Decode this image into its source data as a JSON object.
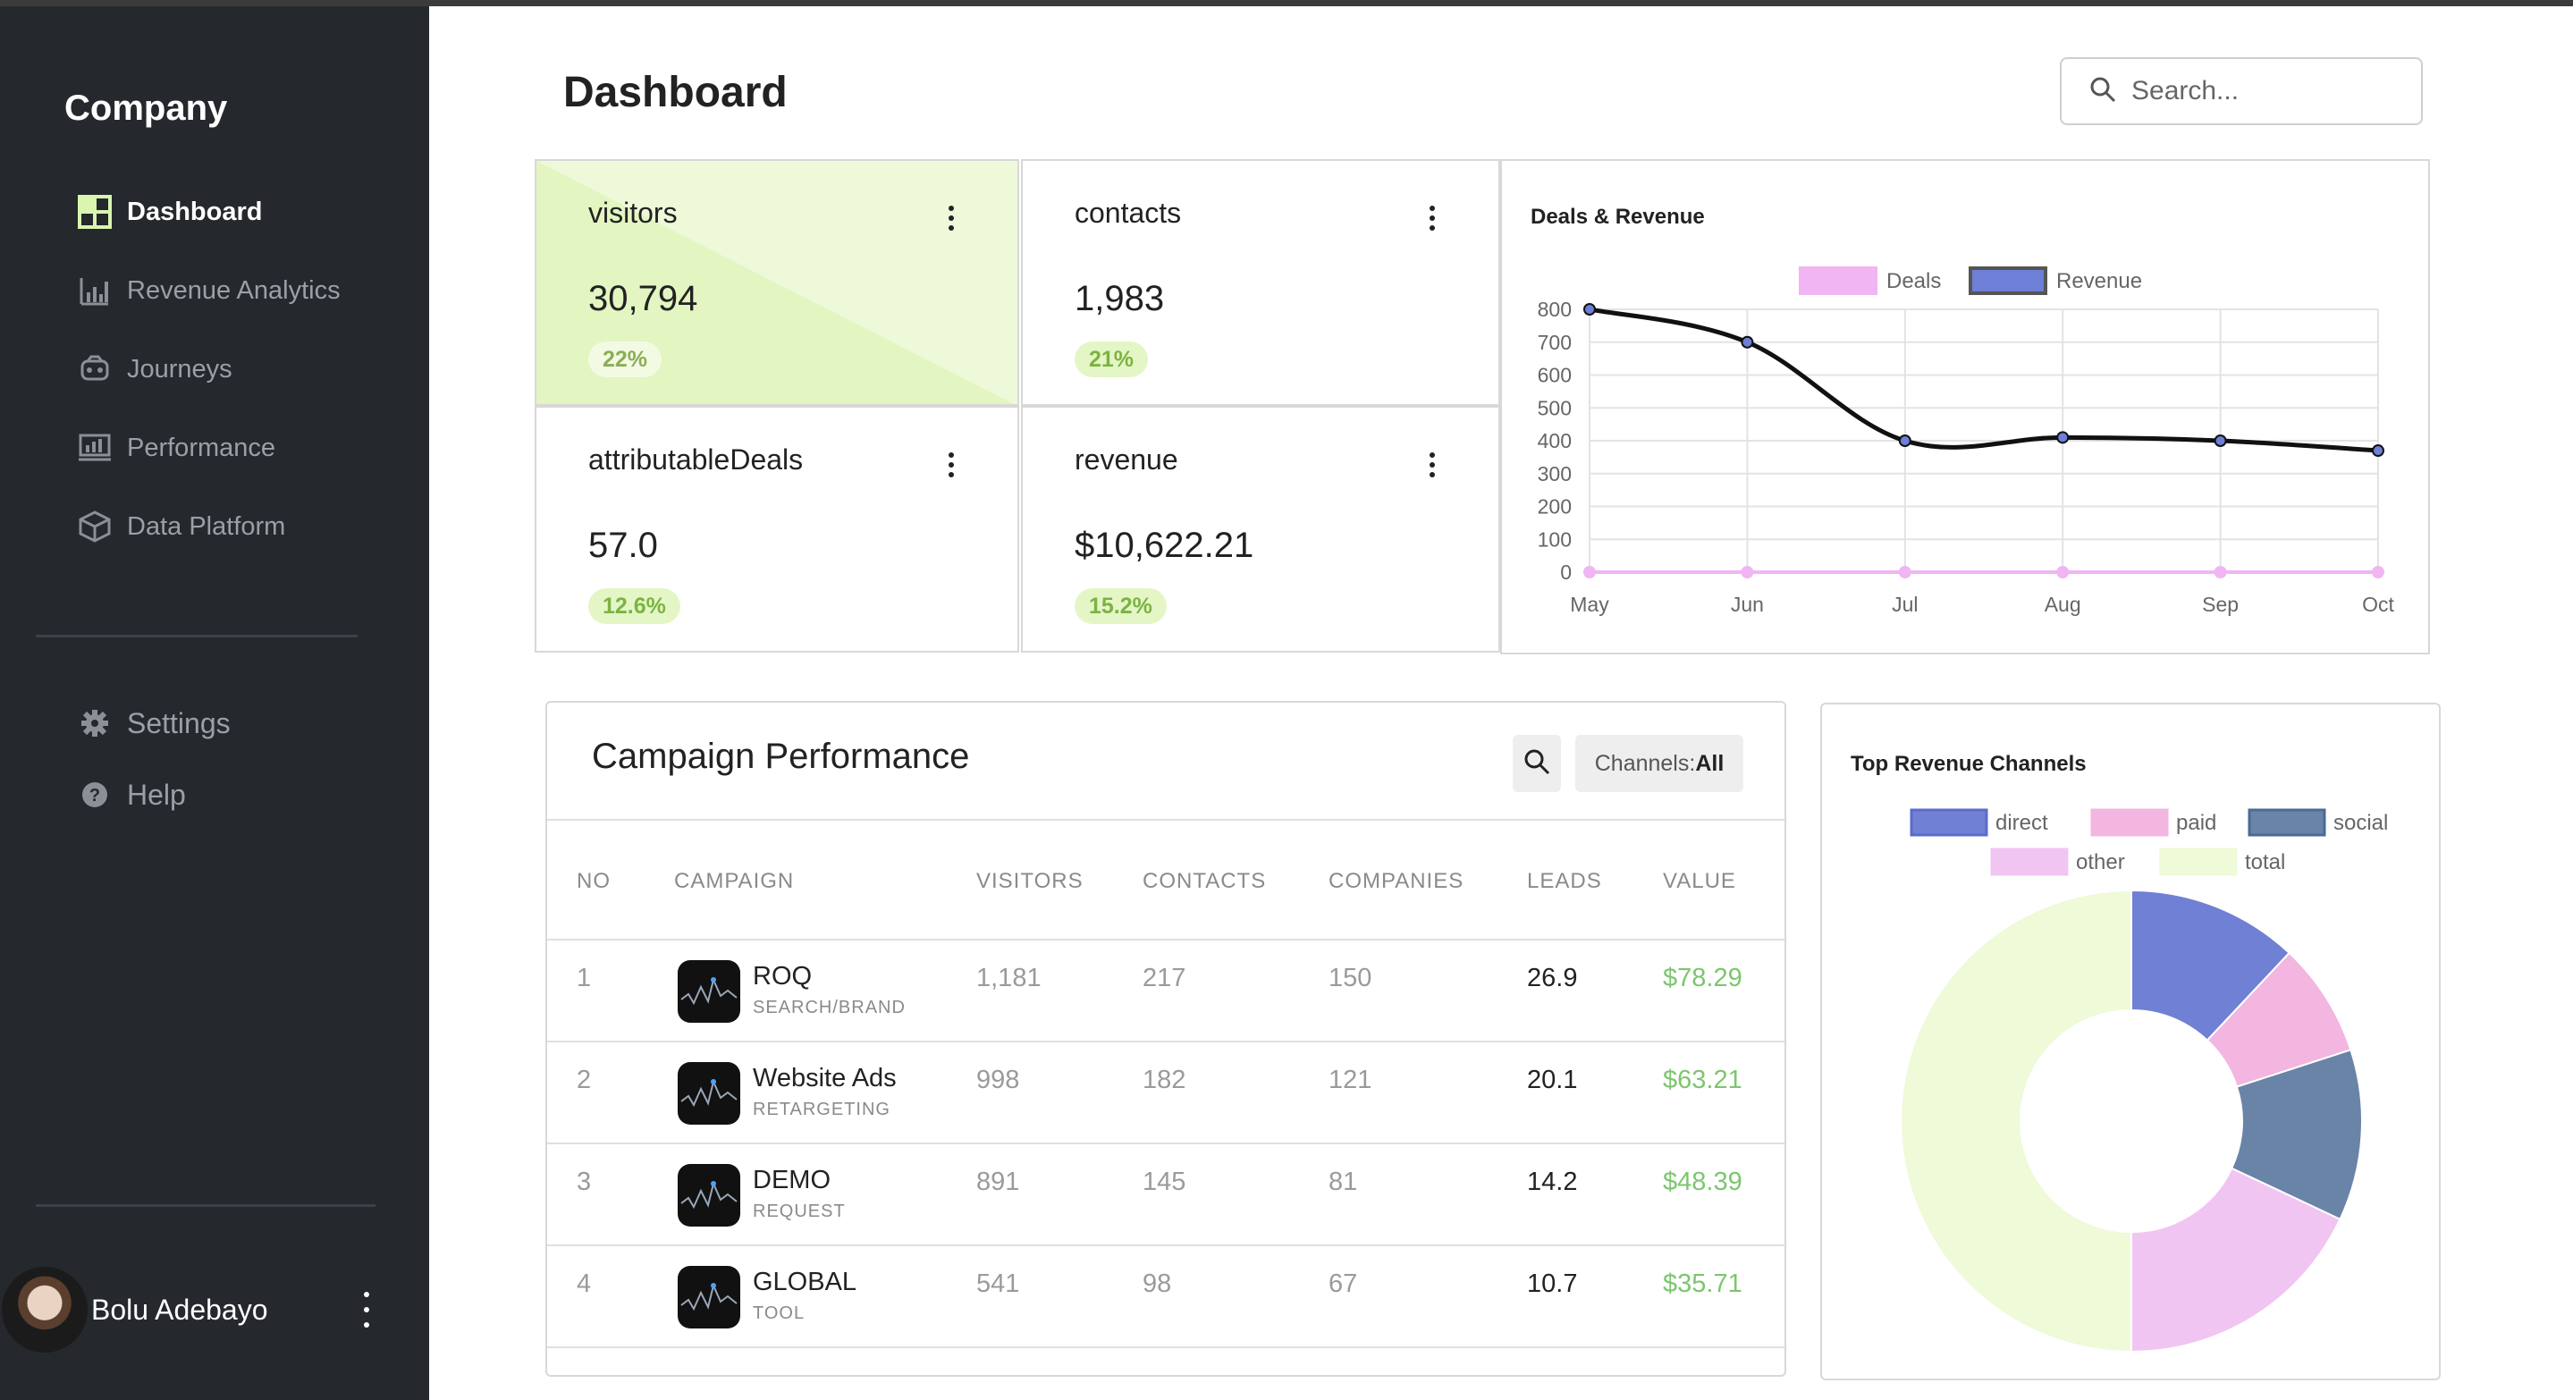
{
  "sidebar": {
    "brand": "Company",
    "items": [
      {
        "label": "Dashboard",
        "icon": "dashboard-grid-icon",
        "active": true
      },
      {
        "label": "Revenue Analytics",
        "icon": "bar-chart-icon",
        "active": false
      },
      {
        "label": "Journeys",
        "icon": "route-icon",
        "active": false
      },
      {
        "label": "Performance",
        "icon": "monitor-chart-icon",
        "active": false
      },
      {
        "label": "Data Platform",
        "icon": "cube-icon",
        "active": false
      }
    ],
    "secondary": [
      {
        "label": "Settings",
        "icon": "gear-icon"
      },
      {
        "label": "Help",
        "icon": "question-circle-icon"
      }
    ],
    "user": {
      "name": "Bolu Adebayo"
    }
  },
  "header": {
    "title": "Dashboard",
    "search_placeholder": "Search..."
  },
  "kpis": [
    {
      "label": "visitors",
      "value": "30,794",
      "change": "22%"
    },
    {
      "label": "contacts",
      "value": "1,983",
      "change": "21%"
    },
    {
      "label": "attributableDeals",
      "value": "57.0",
      "change": "12.6%"
    },
    {
      "label": "revenue",
      "value": "$10,622.21",
      "change": "15.2%"
    }
  ],
  "campaign_table": {
    "title": "Campaign Performance",
    "filter_label": "Channels:",
    "filter_value": "All",
    "columns": [
      "NO",
      "CAMPAIGN",
      "VISITORS",
      "CONTACTS",
      "COMPANIES",
      "LEADS",
      "VALUE"
    ],
    "rows": [
      {
        "no": "1",
        "name": "ROQ",
        "sub": "SEARCH/BRAND",
        "visitors": "1,181",
        "contacts": "217",
        "companies": "150",
        "leads": "26.9",
        "value": "$78.29"
      },
      {
        "no": "2",
        "name": "Website Ads",
        "sub": "RETARGETING",
        "visitors": "998",
        "contacts": "182",
        "companies": "121",
        "leads": "20.1",
        "value": "$63.21"
      },
      {
        "no": "3",
        "name": "DEMO",
        "sub": "REQUEST",
        "visitors": "891",
        "contacts": "145",
        "companies": "81",
        "leads": "14.2",
        "value": "$48.39"
      },
      {
        "no": "4",
        "name": "GLOBAL",
        "sub": "TOOL",
        "visitors": "541",
        "contacts": "98",
        "companies": "67",
        "leads": "10.7",
        "value": "$35.71"
      }
    ]
  },
  "chart_data": [
    {
      "type": "line",
      "title": "Deals & Revenue",
      "categories": [
        "May",
        "Jun",
        "Jul",
        "Aug",
        "Sep",
        "Oct"
      ],
      "ylim": [
        0,
        800
      ],
      "yticks": [
        0,
        100,
        200,
        300,
        400,
        500,
        600,
        700,
        800
      ],
      "grid": true,
      "legend": "top",
      "series": [
        {
          "name": "Deals",
          "values": [
            0,
            0,
            0,
            0,
            0,
            0
          ],
          "color": "#f0b5f2"
        },
        {
          "name": "Revenue",
          "values": [
            800,
            700,
            400,
            410,
            400,
            370
          ],
          "color": "#111111",
          "legend_color": "#6d7fd6"
        }
      ]
    },
    {
      "type": "pie",
      "title": "Top Revenue Channels",
      "legend": "top",
      "labels": [
        "direct",
        "paid",
        "social",
        "other",
        "total"
      ],
      "values": [
        12,
        8,
        12,
        18,
        50
      ],
      "colors": [
        "#7080d4",
        "#f2b6e0",
        "#6a84a8",
        "#f1c5f2",
        "#eefad8"
      ]
    }
  ]
}
